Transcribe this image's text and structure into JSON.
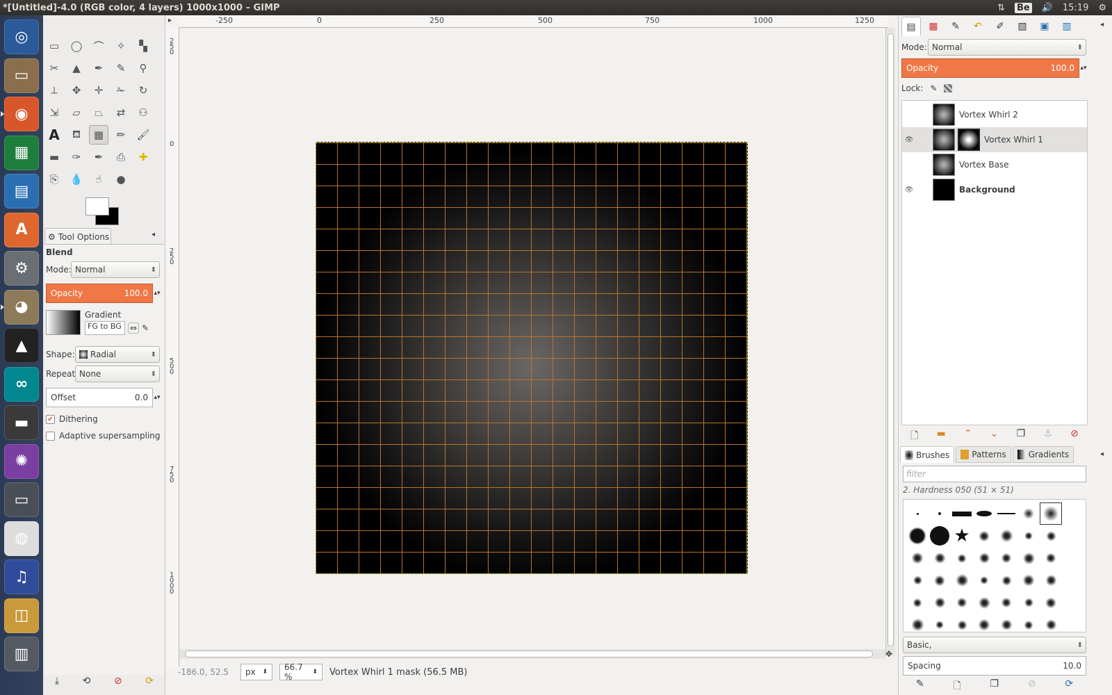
{
  "window": {
    "title": "*[Untitled]-4.0 (RGB color, 4 layers) 1000x1000 – GIMP"
  },
  "tray": {
    "network_icon": "arrows-up-down-icon",
    "keyboard": "Be",
    "volume_icon": "speaker-icon",
    "time": "15:19",
    "settings_icon": "gear-icon"
  },
  "launcher": [
    {
      "name": "ubuntu-home",
      "color": "#2a5a9a"
    },
    {
      "name": "files",
      "color": "#8a6f4d"
    },
    {
      "name": "firefox",
      "color": "#d8572a"
    },
    {
      "name": "libreoffice-calc",
      "color": "#1e7e3e"
    },
    {
      "name": "libreoffice-writer",
      "color": "#2b6fb3"
    },
    {
      "name": "software-center",
      "color": "#e0662f"
    },
    {
      "name": "system-settings",
      "color": "#6a6f74"
    },
    {
      "name": "gimp",
      "color": "#8c7a59"
    },
    {
      "name": "inkscape",
      "color": "#222222"
    },
    {
      "name": "arduino",
      "color": "#00878f"
    },
    {
      "name": "save",
      "color": "#3a3a3a"
    },
    {
      "name": "aperture",
      "color": "#7a3fa0"
    },
    {
      "name": "scanner",
      "color": "#4a4f57"
    },
    {
      "name": "chrome",
      "color": "#dddddd"
    },
    {
      "name": "audacity",
      "color": "#2f4b9a"
    },
    {
      "name": "image-viewer",
      "color": "#c99a3a"
    },
    {
      "name": "trash",
      "color": "#555a62"
    }
  ],
  "toolbox": {
    "tools": [
      "rect-select",
      "ellipse-select",
      "free-select",
      "fuzzy-select",
      "by-color-select",
      "scissors",
      "foreground-select",
      "paths",
      "color-picker",
      "zoom",
      "measure",
      "move",
      "align",
      "crop",
      "rotate",
      "scale",
      "shear",
      "perspective",
      "flip",
      "cage",
      "text",
      "bucket-fill",
      "blend",
      "pencil",
      "paintbrush",
      "eraser",
      "airbrush",
      "ink",
      "clone",
      "heal",
      "perspective-clone",
      "blur",
      "smudge",
      "dodge-burn"
    ],
    "tool_options_tab": "Tool Options",
    "tool_name": "Blend",
    "mode_label": "Mode:",
    "mode_value": "Normal",
    "opacity_label": "Opacity",
    "opacity_value": "100.0",
    "gradient_label": "Gradient",
    "gradient_value": "FG to BG (",
    "shape_label": "Shape:",
    "shape_value": "Radial",
    "repeat_label": "Repeat:",
    "repeat_value": "None",
    "offset_label": "Offset",
    "offset_value": "0.0",
    "dithering_label": "Dithering",
    "dithering_checked": true,
    "adaptive_label": "Adaptive supersampling",
    "adaptive_checked": false
  },
  "canvas": {
    "ruler_h": [
      "-250",
      "0",
      "250",
      "500",
      "750",
      "1000",
      "1250"
    ],
    "ruler_v": [
      [
        "2",
        "5",
        "0"
      ],
      [
        "0"
      ],
      [
        "2",
        "5",
        "0"
      ],
      [
        "5",
        "0",
        "0"
      ],
      [
        "7",
        "5",
        "0"
      ],
      [
        "1",
        "0",
        "0",
        "0"
      ]
    ],
    "status_coords": "-186.0, 52.5",
    "unit": "px",
    "zoom": "66.7 %",
    "status_message": "Vortex Whirl 1 mask (56.5 MB)",
    "grid_color": "#b8742c"
  },
  "layers_panel": {
    "mode_label": "Mode:",
    "mode_value": "Normal",
    "opacity_label": "Opacity",
    "opacity_value": "100.0",
    "lock_label": "Lock:",
    "layers": [
      {
        "name": "Vortex Whirl 2",
        "visible": false,
        "has_mask": false,
        "bold": false,
        "selected": false
      },
      {
        "name": "Vortex Whirl 1",
        "visible": true,
        "has_mask": true,
        "bold": false,
        "selected": true
      },
      {
        "name": "Vortex Base",
        "visible": false,
        "has_mask": false,
        "bold": false,
        "selected": false
      },
      {
        "name": "Background",
        "visible": true,
        "has_mask": false,
        "bold": true,
        "selected": false
      }
    ]
  },
  "brushes_panel": {
    "tabs": [
      "Brushes",
      "Patterns",
      "Gradients"
    ],
    "filter_placeholder": "filter",
    "brush_name": "2. Hardness 050 (51 × 51)",
    "tag_value": "Basic,",
    "spacing_label": "Spacing",
    "spacing_value": "10.0"
  },
  "accent_color": "#f07746"
}
